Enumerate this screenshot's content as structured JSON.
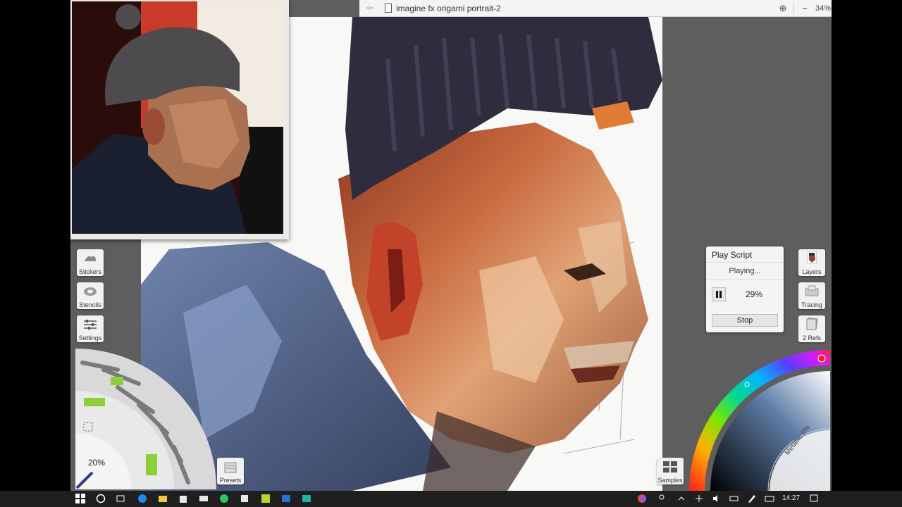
{
  "window": {
    "title": "imagine fx origami portrait-2",
    "zoom": "34%"
  },
  "side_tools": {
    "stickers": "Stickers",
    "stencils": "Stencils",
    "settings": "Settings"
  },
  "tool_wheel": {
    "size_percent": "20%"
  },
  "presets_label": "Presets",
  "play_script": {
    "title": "Play Script",
    "status": "Playing...",
    "progress": "29%",
    "stop_label": "Stop"
  },
  "right_tools": {
    "layers": "Layers",
    "tracing": "Tracing",
    "refs": "2 Refs"
  },
  "samples_label": "Samples",
  "color_picker": {
    "metallic": "Metallic 0%"
  },
  "taskbar": {
    "time": "14:27"
  },
  "colors": {
    "app_bg": "#5e5e5e",
    "panel_bg": "#f4f4f4",
    "hat": "#2f2c3d",
    "skin": "#c8633a"
  }
}
